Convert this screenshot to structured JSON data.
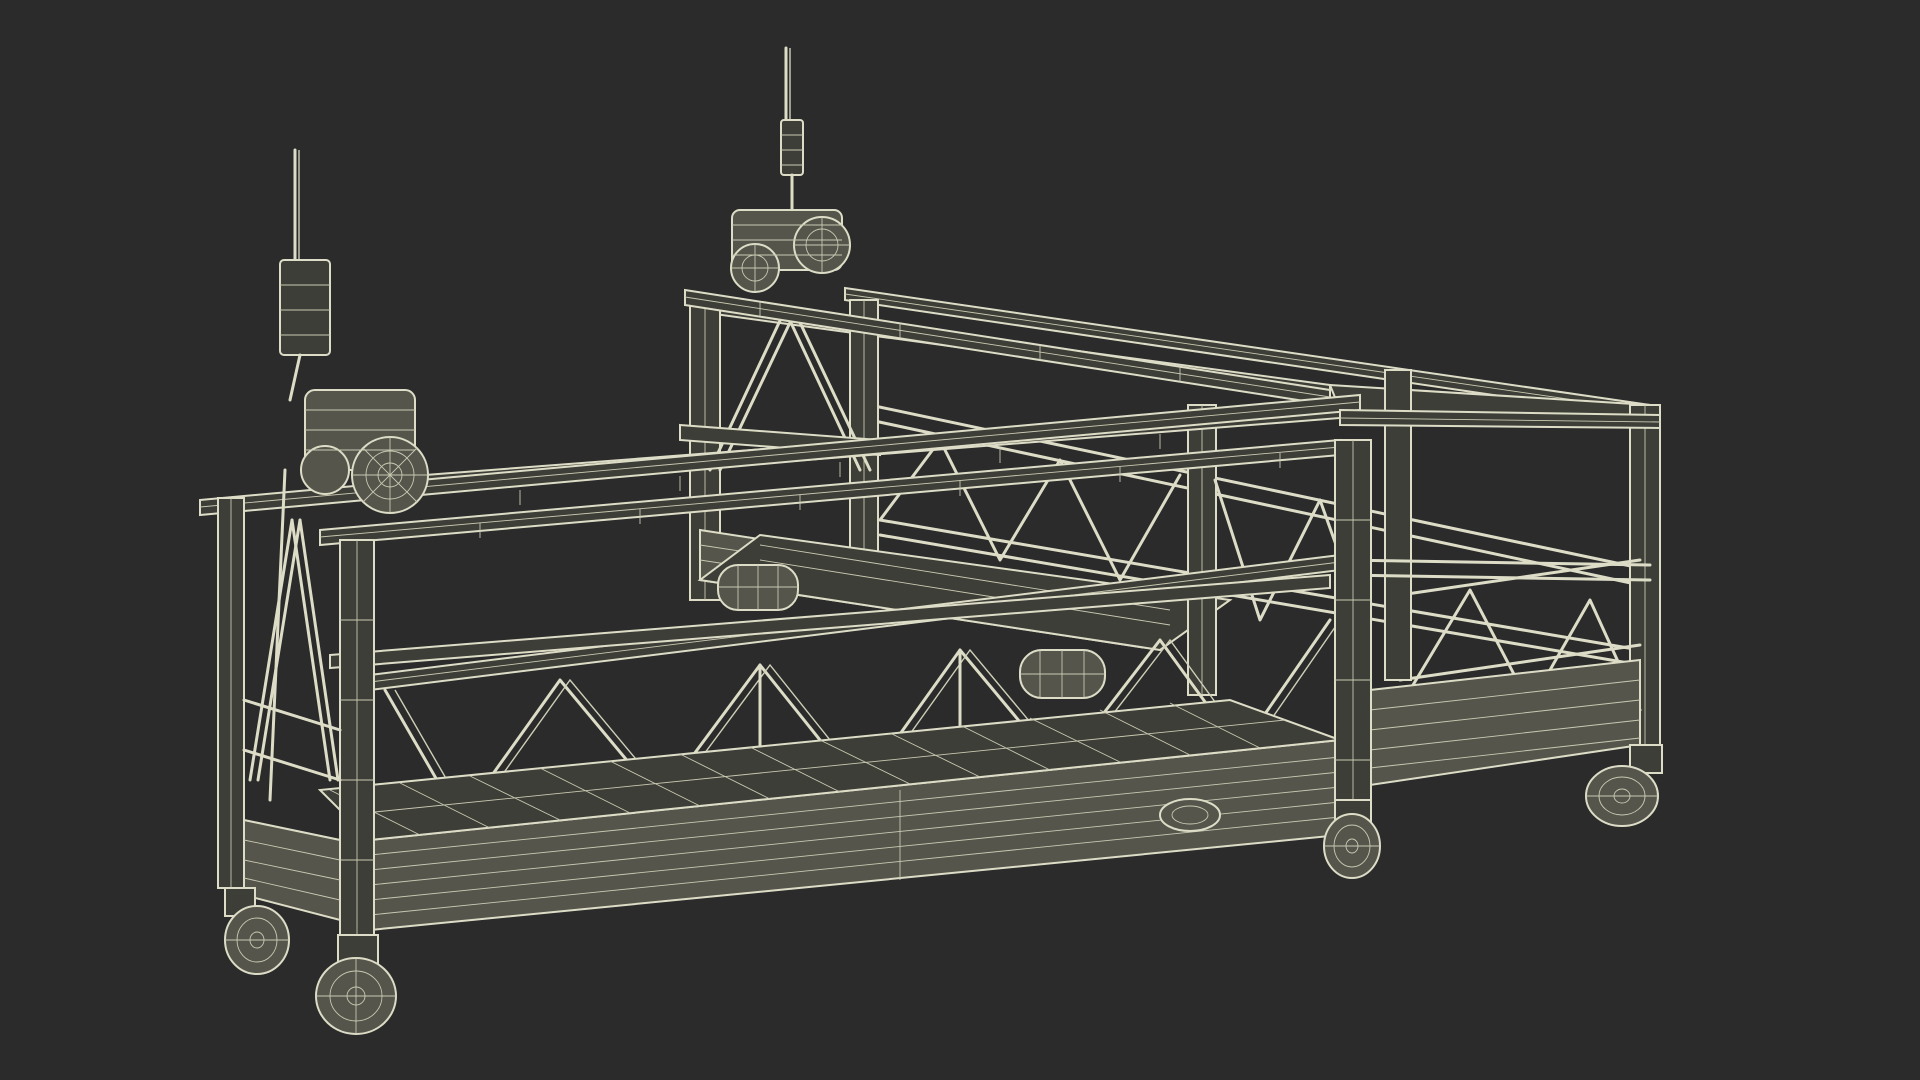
{
  "scene": {
    "background": "#2b2b2b",
    "wire_color": "#ddddc7",
    "render_mode": "wireframe",
    "object": "suspended-platform-gondola"
  },
  "components": {
    "hoist_motors": 2,
    "antenna_units": 2,
    "caster_wheels": 4,
    "truss_panels": 3,
    "outrigger_rollers": 2
  }
}
